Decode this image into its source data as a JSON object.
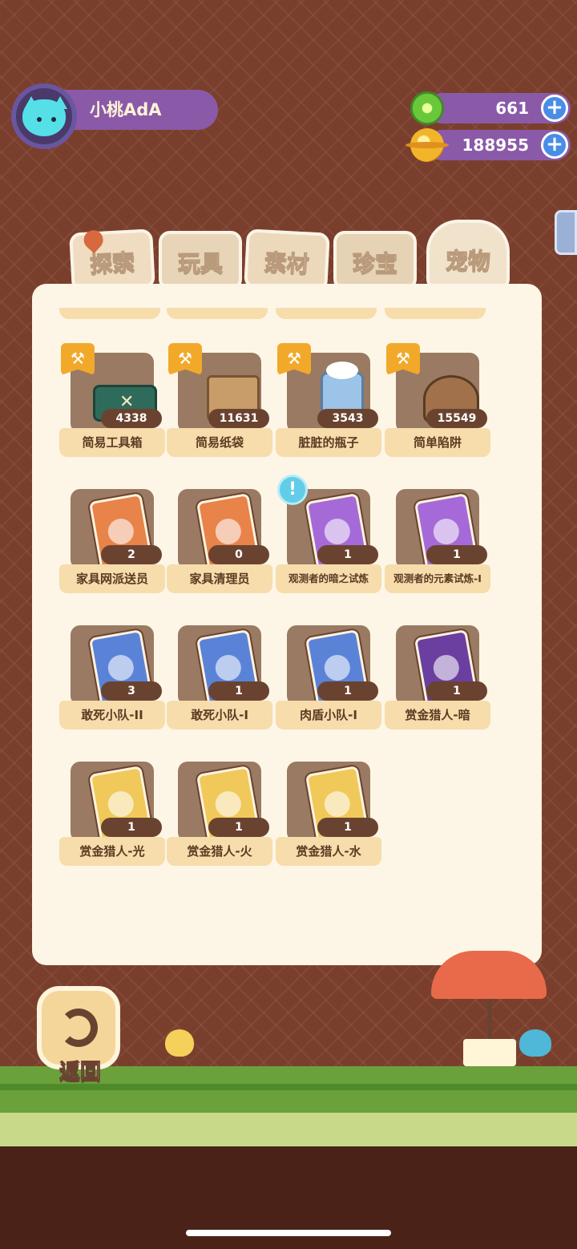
{
  "player": {
    "name": "小桃AdA"
  },
  "currencies": [
    {
      "name": "gem",
      "value": "661"
    },
    {
      "name": "gold",
      "value": "188955"
    }
  ],
  "tabs": [
    {
      "id": "explore",
      "label": "探索"
    },
    {
      "id": "toy",
      "label": "玩具"
    },
    {
      "id": "material",
      "label": "素材"
    },
    {
      "id": "treasure",
      "label": "珍宝"
    },
    {
      "id": "pet",
      "label": "宠物",
      "selected": true
    }
  ],
  "items": [
    {
      "label": "简易工具箱",
      "count": "4338",
      "icon": "toolbox-icon",
      "badge": true
    },
    {
      "label": "简易纸袋",
      "count": "11631",
      "icon": "paper-bag-icon",
      "badge": true
    },
    {
      "label": "脏脏的瓶子",
      "count": "3543",
      "icon": "dirty-bottle-icon",
      "badge": true
    },
    {
      "label": "简单陷阱",
      "count": "15549",
      "icon": "trap-icon",
      "badge": true
    },
    {
      "label": "家具网派送员",
      "count": "2",
      "icon": "card-orange-icon"
    },
    {
      "label": "家具清理员",
      "count": "0",
      "icon": "card-orange-icon"
    },
    {
      "label": "观测者的暗之试炼",
      "count": "1",
      "icon": "card-purple-icon",
      "alert": "!"
    },
    {
      "label": "观测者的元素试炼-I",
      "count": "1",
      "icon": "card-purple-icon"
    },
    {
      "label": "敢死小队-II",
      "count": "3",
      "icon": "card-blue-icon"
    },
    {
      "label": "敢死小队-I",
      "count": "1",
      "icon": "card-blue-icon"
    },
    {
      "label": "肉盾小队-I",
      "count": "1",
      "icon": "card-blue-icon"
    },
    {
      "label": "赏金猎人-暗",
      "count": "1",
      "icon": "card-dark-purple-icon"
    },
    {
      "label": "赏金猎人-光",
      "count": "1",
      "icon": "card-gold-icon"
    },
    {
      "label": "赏金猎人-火",
      "count": "1",
      "icon": "card-gold-icon"
    },
    {
      "label": "赏金猎人-水",
      "count": "1",
      "icon": "card-gold-icon"
    }
  ],
  "back_button": {
    "label": "返回"
  },
  "plus_symbol": "+"
}
